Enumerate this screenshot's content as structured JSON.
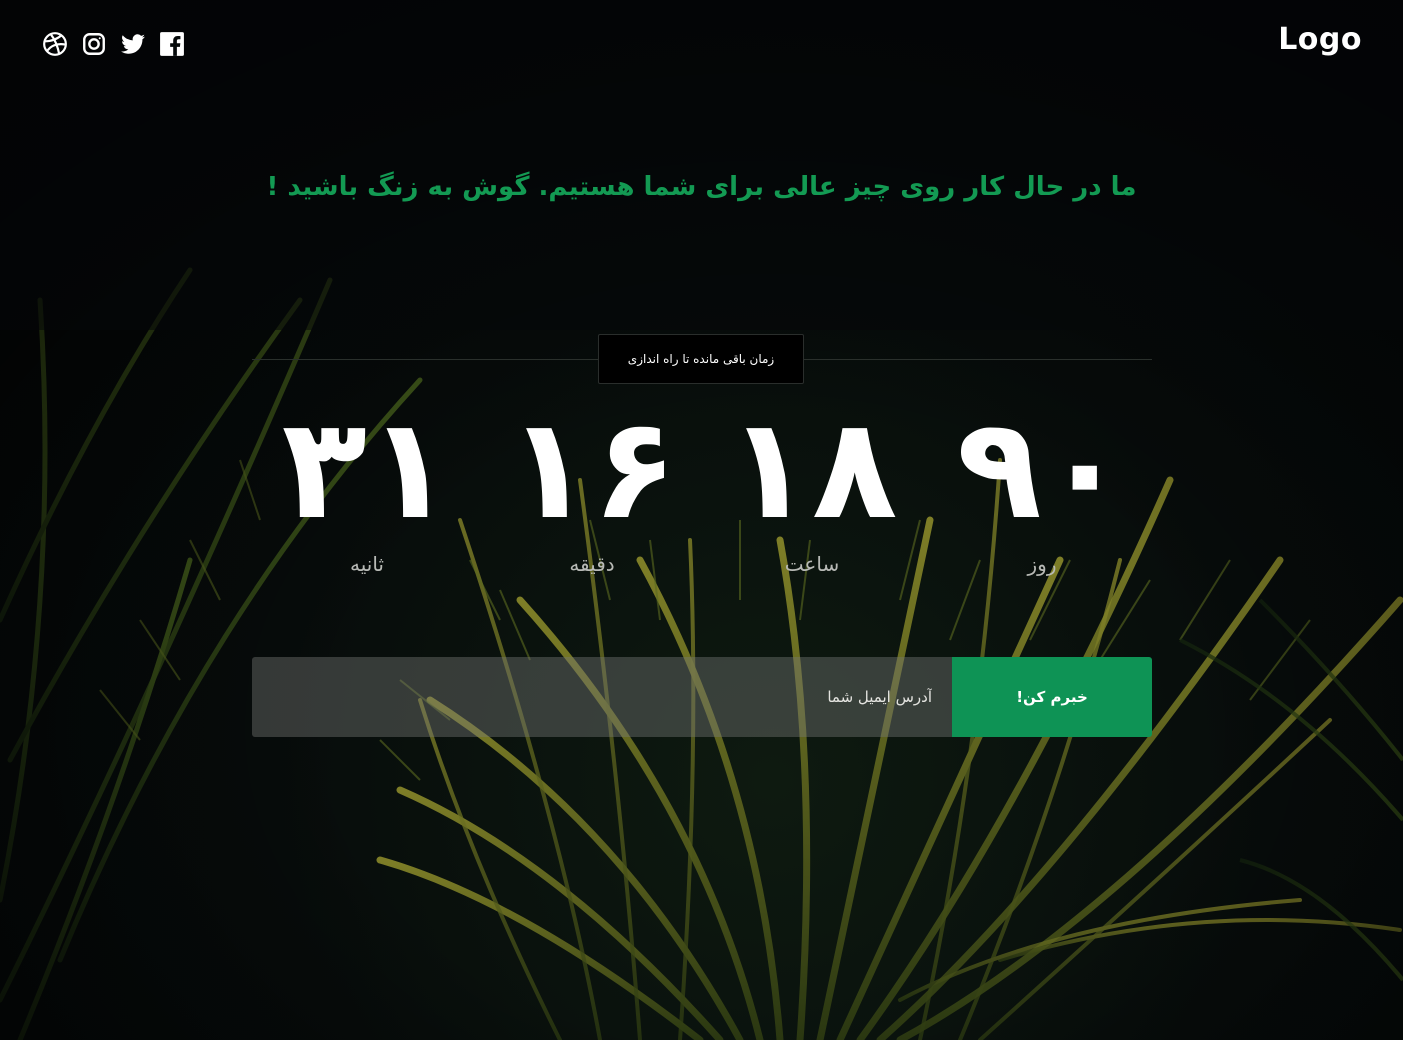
{
  "header": {
    "logo": "Logo",
    "socials": [
      {
        "name": "dribbble-icon"
      },
      {
        "name": "instagram-icon"
      },
      {
        "name": "twitter-icon"
      },
      {
        "name": "facebook-icon"
      }
    ]
  },
  "hero": {
    "tagline": "ما در حال کار روی چیز عالی برای شما هستیم. گوش به زنگ باشید !"
  },
  "countdown": {
    "caption": "زمان باقی مانده تا راه اندازی",
    "days": {
      "value": "۹۰",
      "label": "روز"
    },
    "hours": {
      "value": "۱۸",
      "label": "ساعت"
    },
    "minutes": {
      "value": "۱۶",
      "label": "دقیقه"
    },
    "seconds": {
      "value": "۳۱",
      "label": "ثانیه"
    }
  },
  "subscribe": {
    "placeholder": "آدرس ایمیل شما",
    "button_label": "خبرم کن!"
  },
  "colors": {
    "accent": "#0e9355",
    "tagline": "#139a53",
    "background": "#060a0b"
  }
}
